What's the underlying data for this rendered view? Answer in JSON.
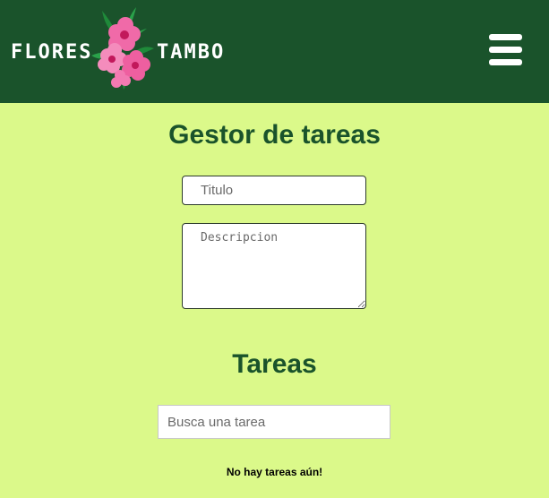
{
  "header": {
    "logo": {
      "word_left": "FLORES",
      "word_right": "TAMBO"
    },
    "menu_icon": "hamburger-menu-icon"
  },
  "form": {
    "heading": "Gestor de tareas",
    "title_placeholder": "Titulo",
    "description_placeholder": "Descripcion"
  },
  "tasks": {
    "heading": "Tareas",
    "search_placeholder": "Busca una tarea",
    "empty_message": "No hay tareas aún!"
  },
  "colors": {
    "header_bg": "#1a532b",
    "page_bg": "#dbf98a",
    "heading": "#1a532b"
  }
}
